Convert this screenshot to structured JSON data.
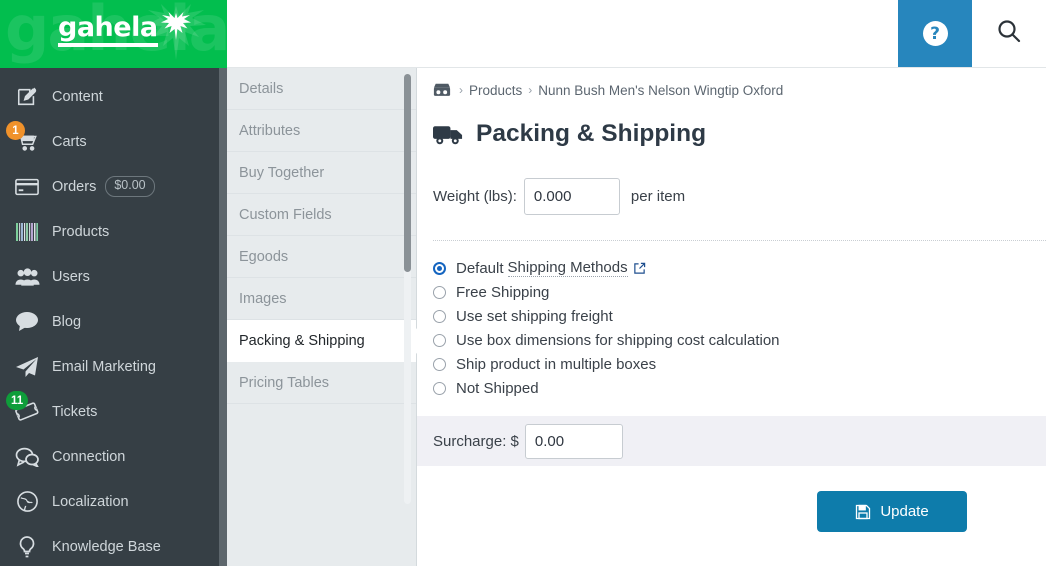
{
  "brand": {
    "name": "gahela",
    "leaf_icon": "cannabis-leaf-icon",
    "bg_color": "#02be4e"
  },
  "topbar": {
    "help_label": "?",
    "help_icon": "question-mark-icon",
    "help_bg_color": "#2786bd",
    "search_icon": "search-icon"
  },
  "sidebar": {
    "bg_color": "#363f45",
    "items": [
      {
        "label": "Content",
        "icon": "edit-document-icon"
      },
      {
        "label": "Carts",
        "icon": "shopping-cart-icon",
        "badge": "1",
        "badge_color": "#f0922b"
      },
      {
        "label": "Orders",
        "icon": "credit-card-icon",
        "pill": "$0.00"
      },
      {
        "label": "Products",
        "icon": "barcode-icon"
      },
      {
        "label": "Users",
        "icon": "users-group-icon"
      },
      {
        "label": "Blog",
        "icon": "speech-bubble-icon"
      },
      {
        "label": "Email Marketing",
        "icon": "paper-plane-icon"
      },
      {
        "label": "Tickets",
        "icon": "ticket-icon",
        "badge": "11",
        "badge_color": "#0f9d3a"
      },
      {
        "label": "Connection",
        "icon": "chat-bubbles-icon"
      },
      {
        "label": "Localization",
        "icon": "globe-icon"
      },
      {
        "label": "Knowledge Base",
        "icon": "lightbulb-icon"
      }
    ]
  },
  "tabs": {
    "items": [
      {
        "label": "Details",
        "active": false
      },
      {
        "label": "Attributes",
        "active": false
      },
      {
        "label": "Buy Together",
        "active": false
      },
      {
        "label": "Custom Fields",
        "active": false
      },
      {
        "label": "Egoods",
        "active": false
      },
      {
        "label": "Images",
        "active": false
      },
      {
        "label": "Packing & Shipping",
        "active": true
      },
      {
        "label": "Pricing Tables",
        "active": false
      }
    ]
  },
  "breadcrumb": {
    "home_icon": "store-home-icon",
    "separator": "›",
    "items": [
      {
        "label": "Products"
      },
      {
        "label": "Nunn Bush Men's Nelson Wingtip Oxford"
      }
    ]
  },
  "page": {
    "title": "Packing & Shipping",
    "title_icon": "delivery-truck-icon"
  },
  "weight": {
    "label": "Weight (lbs):",
    "value": "0.000",
    "placeholder": "0.000",
    "suffix": "per item"
  },
  "shipping_options": {
    "selected_index": 0,
    "items": [
      {
        "label_prefix": "Default",
        "link_text": "Shipping Methods",
        "has_external_link": true,
        "external_icon": "external-link-icon",
        "checked": true
      },
      {
        "label_prefix": "Free Shipping",
        "checked": false
      },
      {
        "label_prefix": "Use set shipping freight",
        "checked": false
      },
      {
        "label_prefix": "Use box dimensions for shipping cost calculation",
        "checked": false
      },
      {
        "label_prefix": "Ship product in multiple boxes",
        "checked": false
      },
      {
        "label_prefix": "Not Shipped",
        "checked": false
      }
    ]
  },
  "surcharge": {
    "label": "Surcharge: $",
    "value": "0.00",
    "placeholder": "0.00",
    "band_color": "#f0f0f5"
  },
  "actions": {
    "update_label": "Update",
    "update_icon": "save-floppy-icon",
    "update_color": "#0e7cab"
  }
}
